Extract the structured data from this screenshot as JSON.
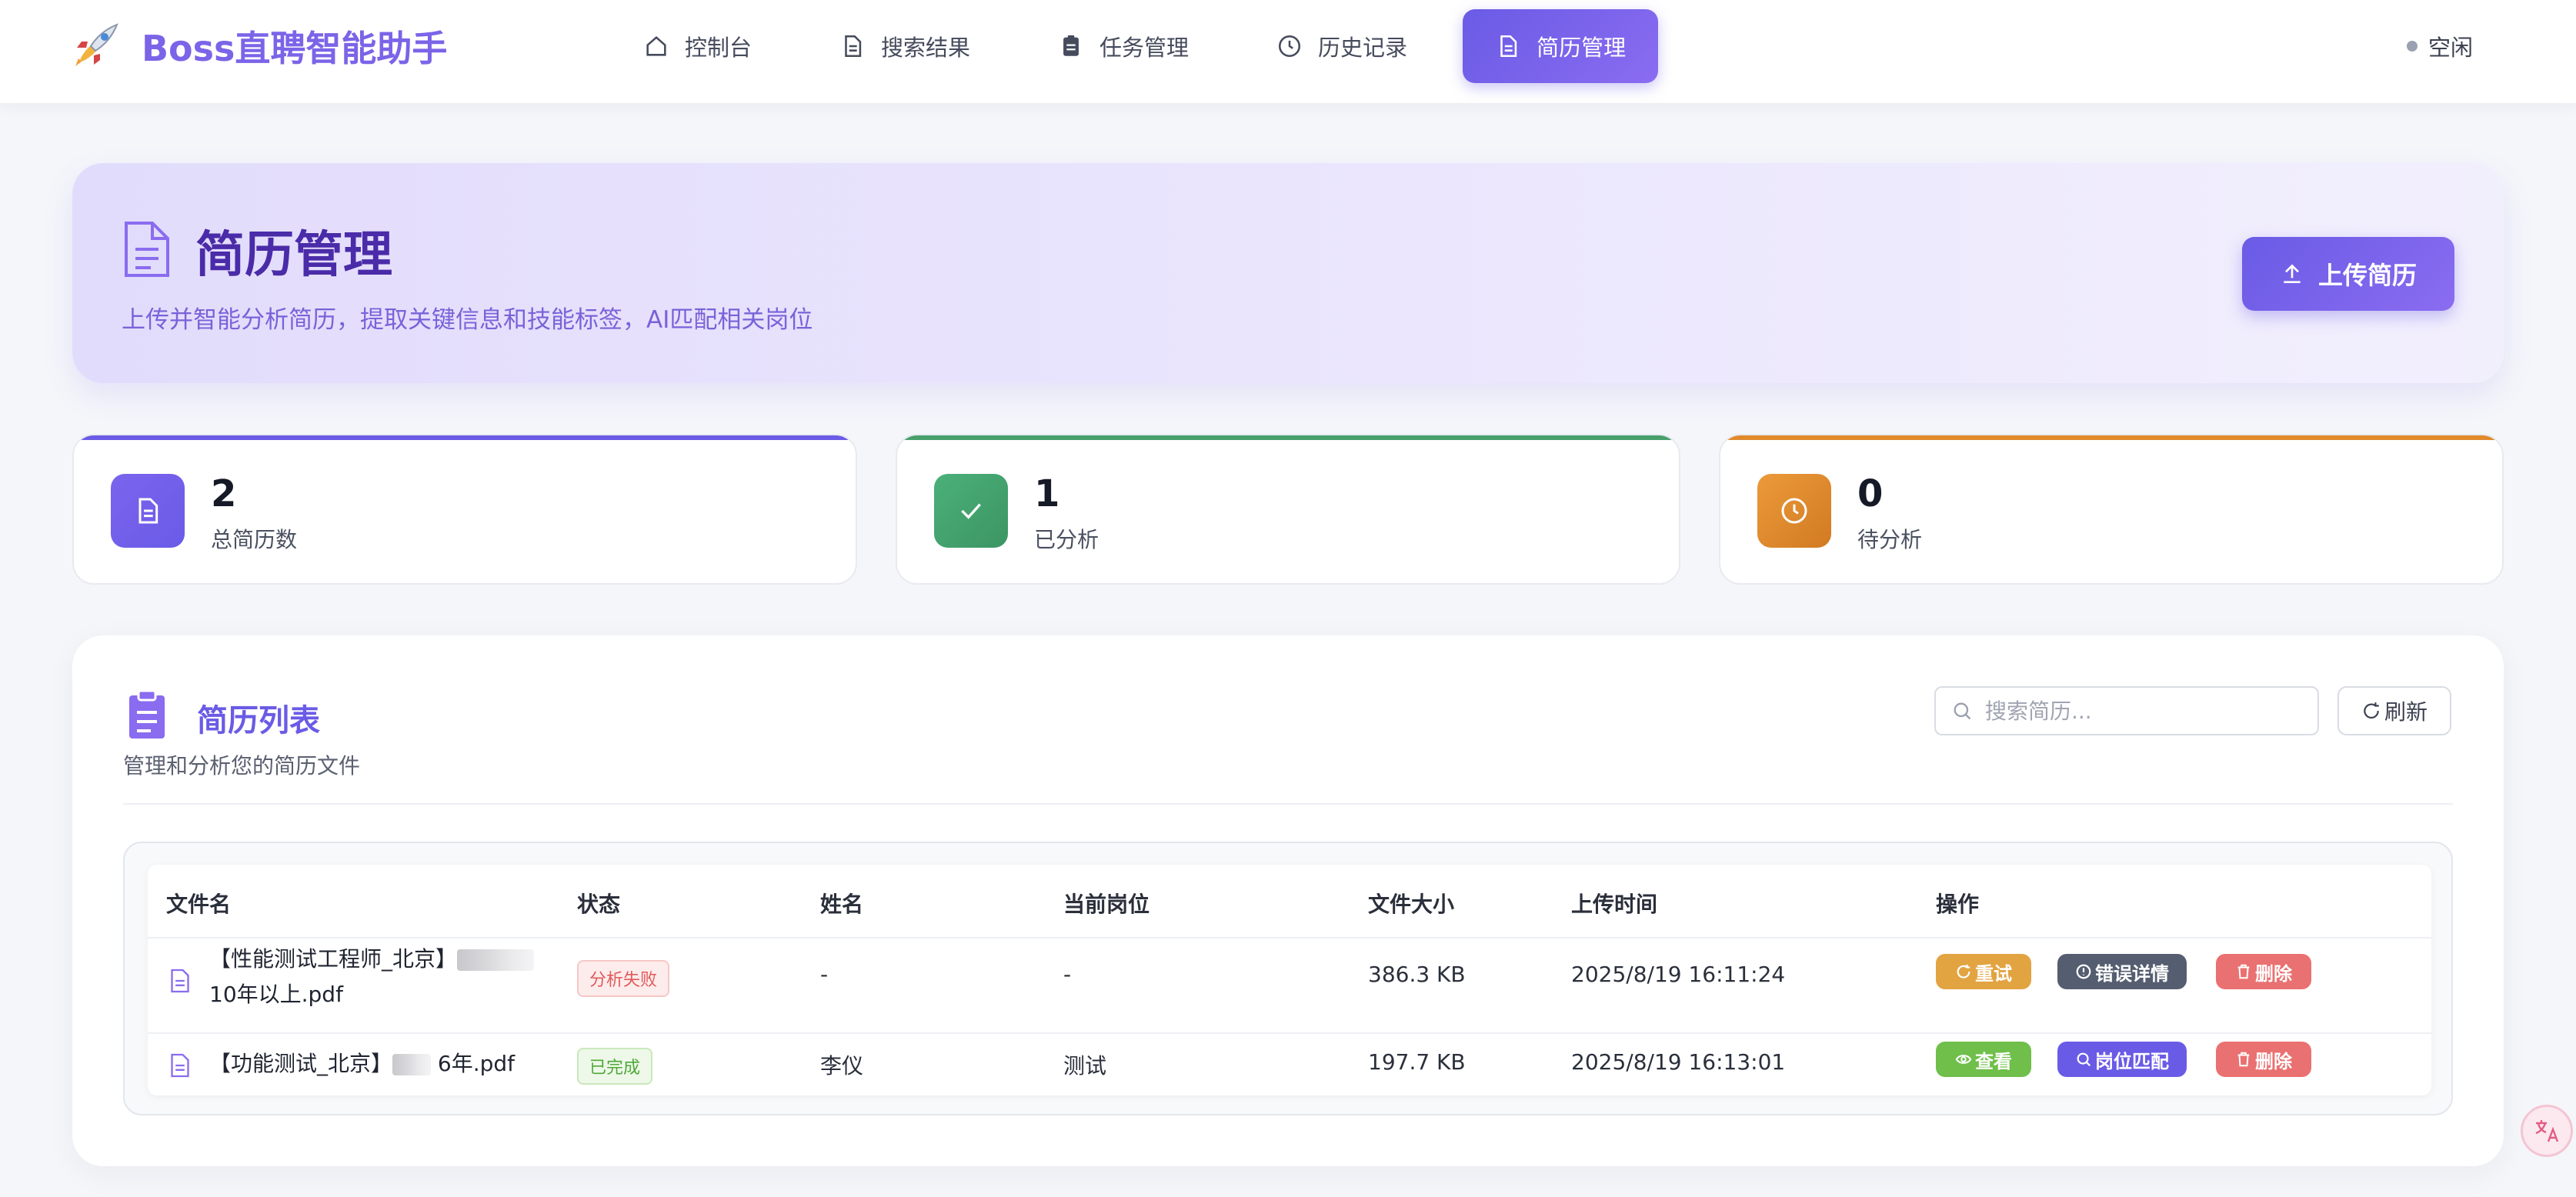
{
  "app": {
    "title": "Boss直聘智能助手"
  },
  "nav": {
    "items": [
      {
        "label": "控制台",
        "icon": "home-icon"
      },
      {
        "label": "搜索结果",
        "icon": "document-icon"
      },
      {
        "label": "任务管理",
        "icon": "clipboard-icon"
      },
      {
        "label": "历史记录",
        "icon": "clock-icon"
      },
      {
        "label": "简历管理",
        "icon": "document-icon",
        "active": true
      }
    ],
    "status": "空闲"
  },
  "hero": {
    "title": "简历管理",
    "subtitle": "上传并智能分析简历，提取关键信息和技能标签，AI匹配相关岗位",
    "upload_label": "上传简历"
  },
  "stats": [
    {
      "value": "2",
      "label": "总简历数",
      "color": "#6a5be6"
    },
    {
      "value": "1",
      "label": "已分析",
      "color": "#48a06c"
    },
    {
      "value": "0",
      "label": "待分析",
      "color": "#e08a2c"
    }
  ],
  "list": {
    "title": "简历列表",
    "subtitle": "管理和分析您的简历文件",
    "search_placeholder": "搜索简历...",
    "refresh_label": "刷新",
    "columns": [
      "文件名",
      "状态",
      "姓名",
      "当前岗位",
      "文件大小",
      "上传时间",
      "操作"
    ],
    "rows": [
      {
        "file_line1": "【性能测试工程师_北京】",
        "file_line2": "10年以上.pdf",
        "status": "分析失败",
        "name": "-",
        "position": "-",
        "size": "386.3 KB",
        "time": "2025/8/19 16:11:24",
        "actions": [
          "重试",
          "错误详情",
          "删除"
        ]
      },
      {
        "file_line1": "【功能测试_北京】",
        "file_line2": " 6年.pdf",
        "status": "已完成",
        "name": "李仪",
        "position": "测试",
        "size": "197.7 KB",
        "time": "2025/8/19 16:13:01",
        "actions": [
          "查看",
          "岗位匹配",
          "删除"
        ]
      }
    ]
  },
  "colors": {
    "accent": "#6a5be6",
    "success": "#48a06c",
    "warning": "#e08a2c",
    "danger": "#ea7171"
  }
}
